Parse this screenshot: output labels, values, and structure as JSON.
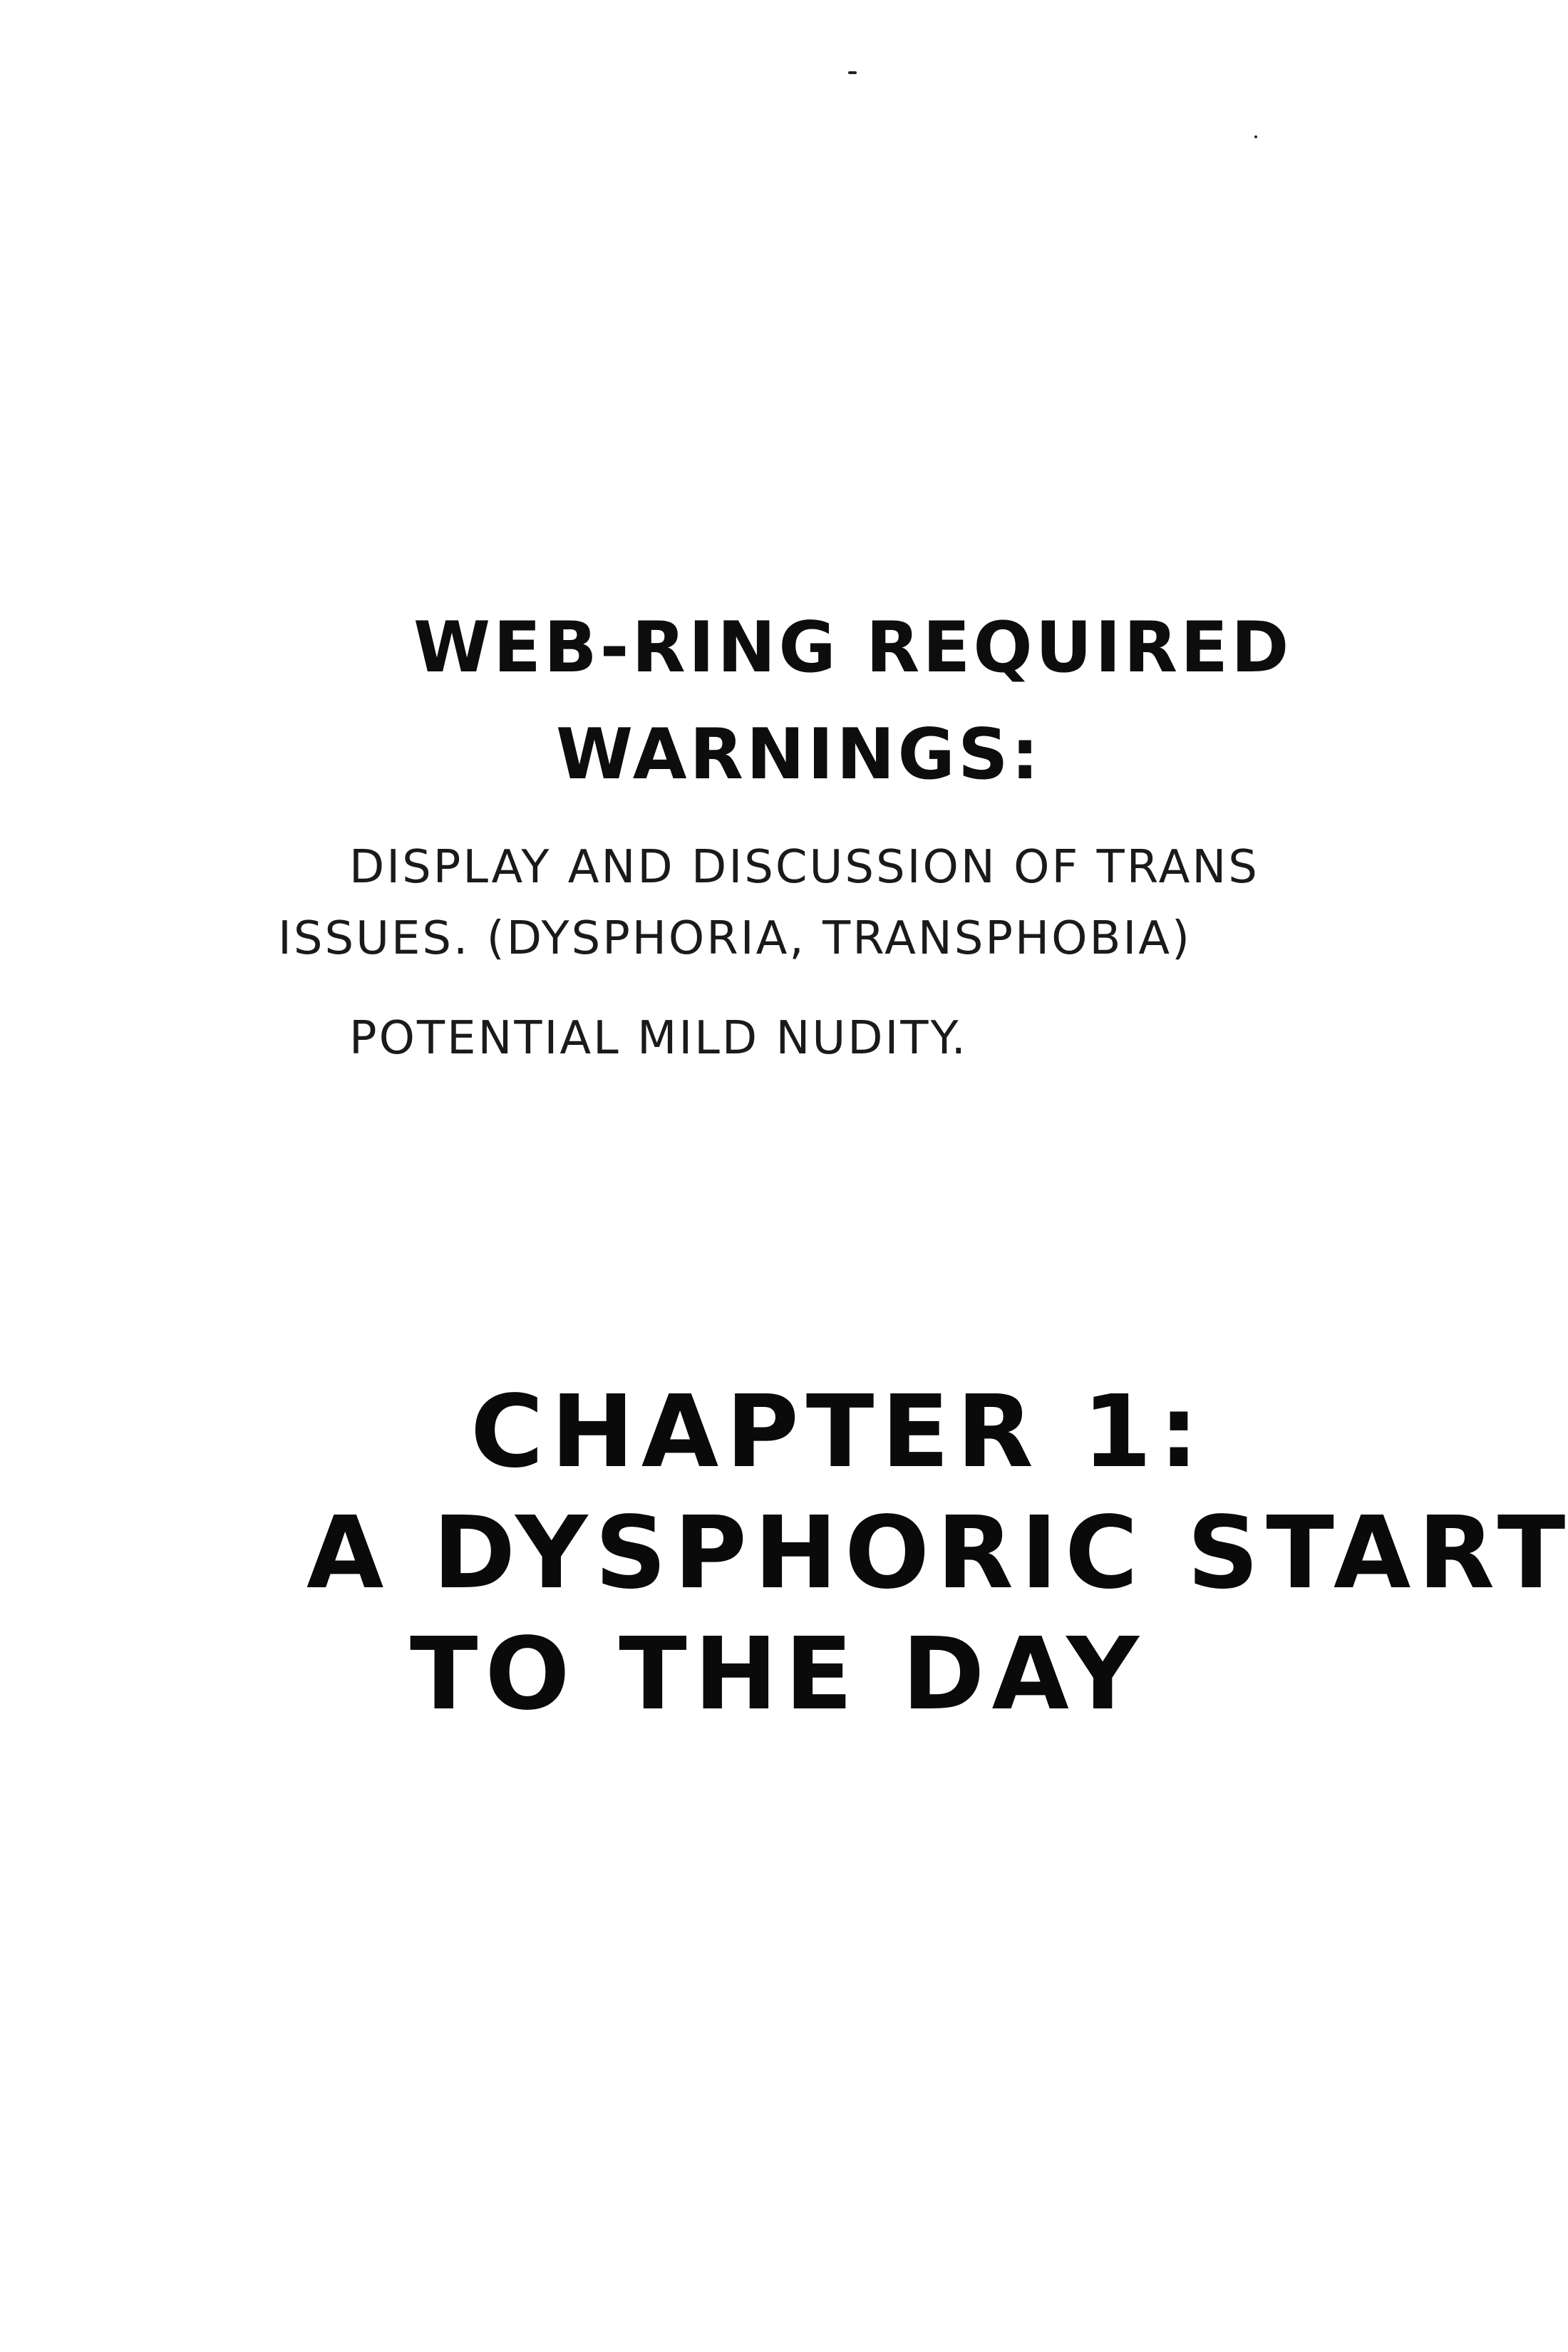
{
  "warnings_section": {
    "heading_line_1": "WEB-RING REQUIRED",
    "heading_line_2": "WARNINGS:",
    "item_1_line_1": "DISPLAY AND DISCUSSION OF TRANS",
    "item_1_line_2": "ISSUES. (DYSPHORIA, TRANSPHOBIA)",
    "item_2": "POTENTIAL MILD NUDITY."
  },
  "chapter_title": {
    "line_1": "CHAPTER 1:",
    "line_2": "A DYSPHORIC START",
    "line_3": "TO THE DAY"
  }
}
